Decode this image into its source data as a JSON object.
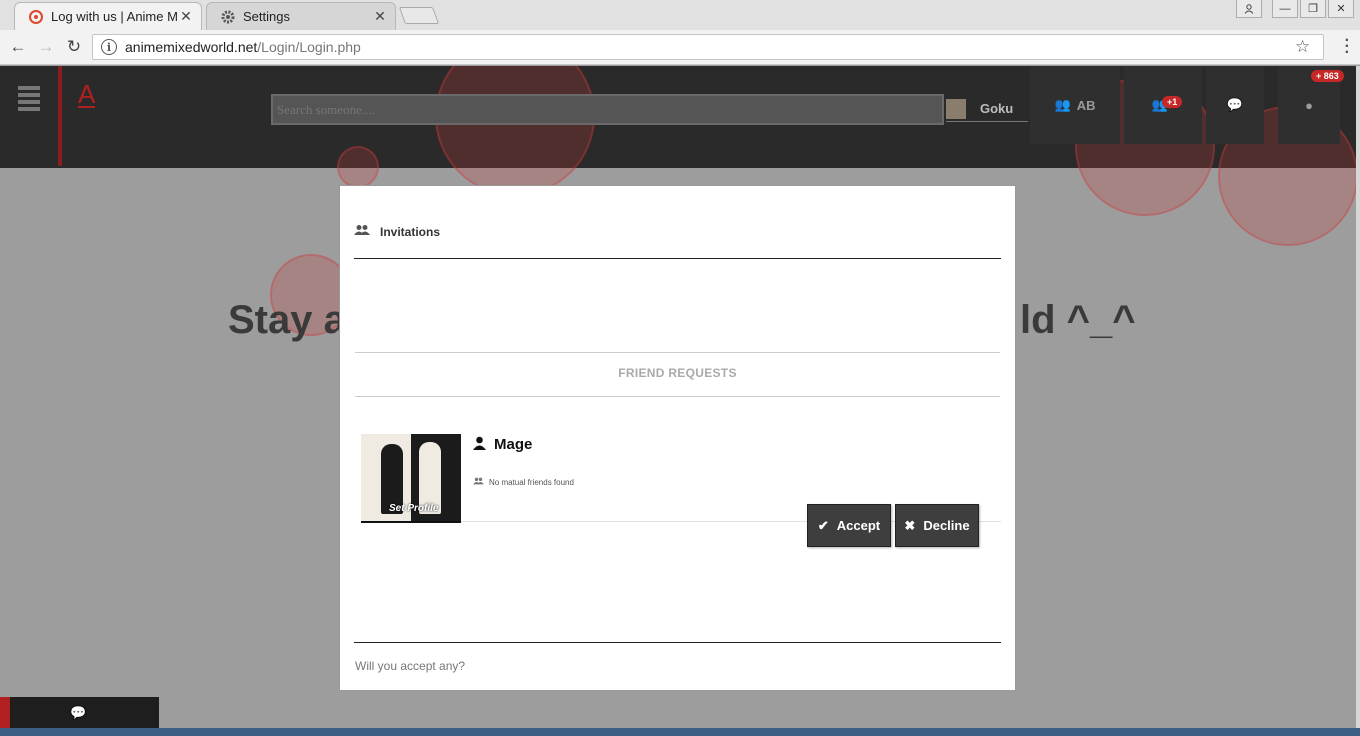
{
  "browser": {
    "tabs": [
      {
        "title": "Log with us | Anime Mixe",
        "icon": "site-favicon",
        "active": true
      },
      {
        "title": "Settings",
        "icon": "gear-icon",
        "active": false
      }
    ],
    "url_host": "animemixedworld.net",
    "url_path": "/Login/Login.php"
  },
  "site": {
    "logo": "A",
    "search_placeholder": "Search someone....",
    "user_name": "Goku",
    "group_label": "AB",
    "friend_badge": "+1",
    "global_badge": "+ 863",
    "headline_left": "Stay a",
    "headline_right": "ld ^_^"
  },
  "modal": {
    "title": "Invitations",
    "section_title": "FRIEND REQUESTS",
    "request": {
      "name": "Mage",
      "avatar_label": "Set Profile",
      "mutual": "No matual friends found"
    },
    "accept_label": "Accept",
    "decline_label": "Decline",
    "footer": "Will you accept any?"
  },
  "colors": {
    "header_bg": "#2a2a2a",
    "accent_red": "#b12020",
    "button_bg": "#3e3e3e"
  }
}
